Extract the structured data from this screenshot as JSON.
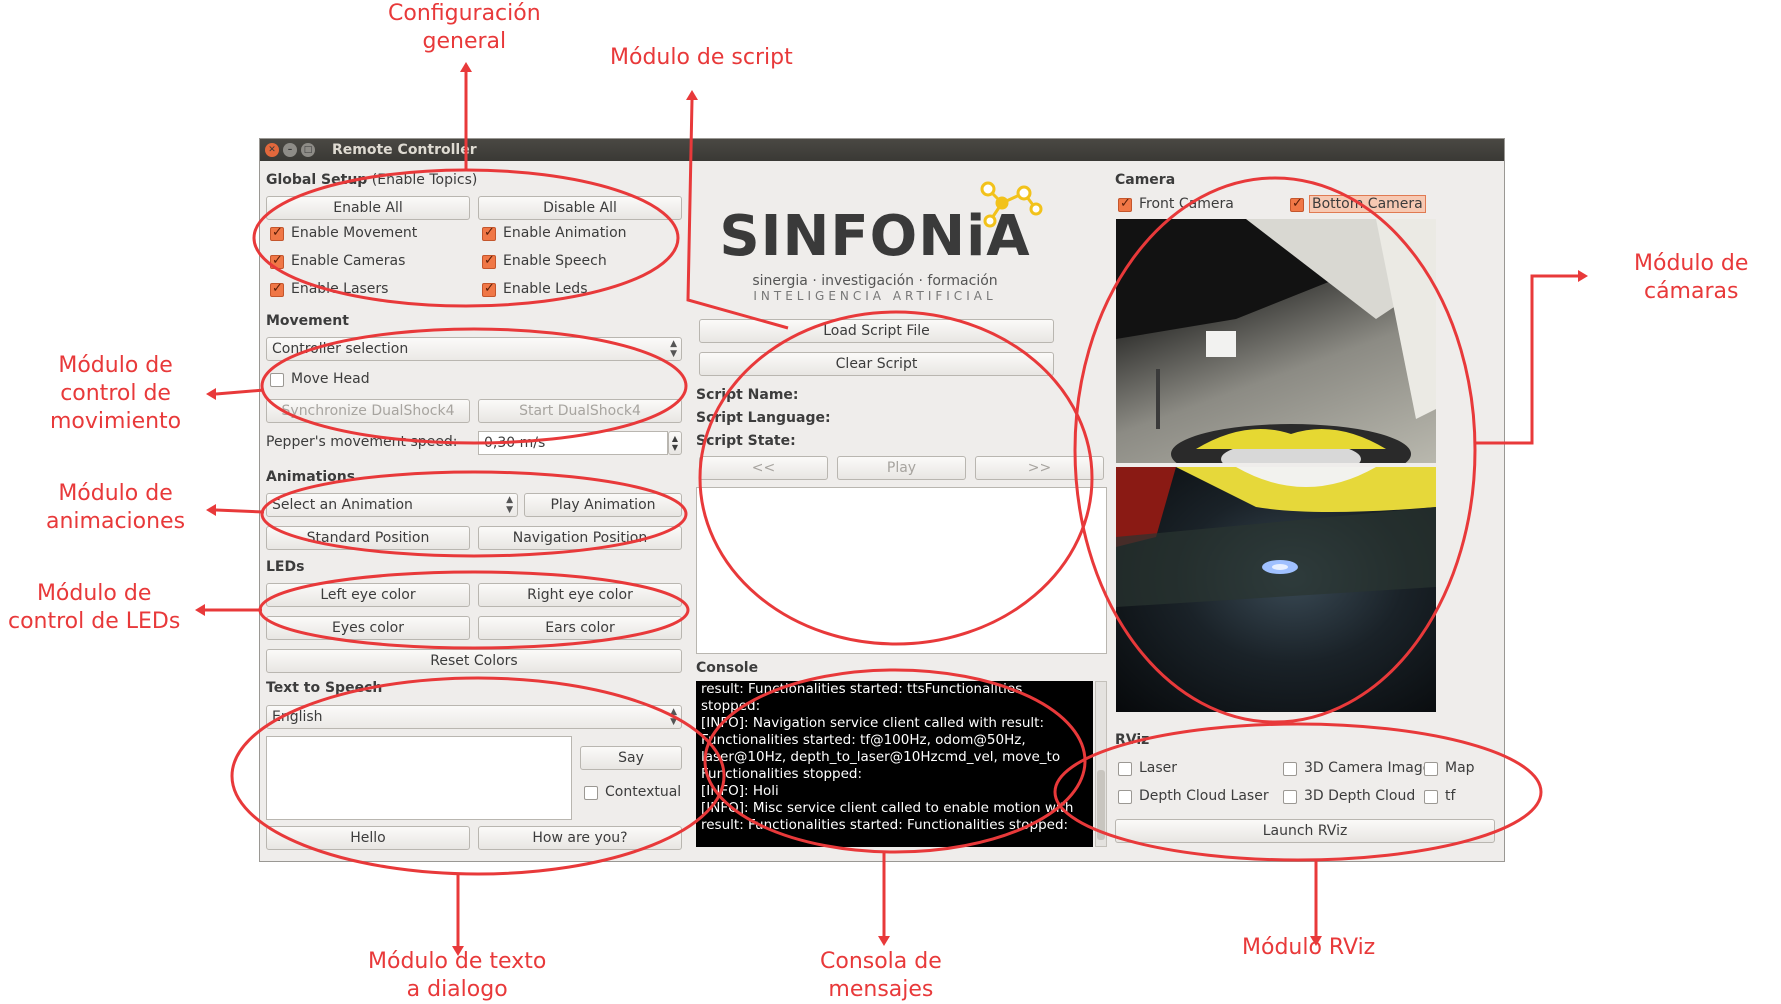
{
  "window": {
    "title": "Remote Controller"
  },
  "global_setup": {
    "header_bold": "Global Setup",
    "header_rest": "(Enable Topics)",
    "enable_all": "Enable All",
    "disable_all": "Disable All",
    "checks": [
      {
        "label": "Enable Movement",
        "checked": true
      },
      {
        "label": "Enable Animation",
        "checked": true
      },
      {
        "label": "Enable Cameras",
        "checked": true
      },
      {
        "label": "Enable Speech",
        "checked": true
      },
      {
        "label": "Enable Lasers",
        "checked": true
      },
      {
        "label": "Enable Leds",
        "checked": true
      }
    ]
  },
  "movement": {
    "header": "Movement",
    "controller_selection": "Controller selection",
    "move_head": "Move Head",
    "sync_dualshock": "Synchronize DualShock4",
    "start_dualshock": "Start DualShock4",
    "speed_label": "Pepper's movement speed:",
    "speed_value": "0,30 m/s"
  },
  "animations": {
    "header": "Animations",
    "select": "Select an Animation",
    "play": "Play Animation",
    "standard": "Standard Position",
    "navigation": "Navigation Position"
  },
  "leds": {
    "header": "LEDs",
    "left_eye": "Left eye color",
    "right_eye": "Right eye color",
    "eyes": "Eyes color",
    "ears": "Ears color",
    "reset": "Reset Colors"
  },
  "tts": {
    "header": "Text to Speech",
    "language": "English",
    "say": "Say",
    "contextual": "Contextual",
    "hello": "Hello",
    "how_are_you": "How are you?"
  },
  "logo": {
    "name": "SINFONiA",
    "tagline1": "sinergia · investigación · formación",
    "tagline2": "INTELIGENCIA ARTIFICIAL",
    "colors": {
      "text": "#3a3a3a",
      "accent": "#f2c21b",
      "accent2": "#1f7fc7"
    }
  },
  "script": {
    "load": "Load Script File",
    "clear": "Clear Script",
    "name_label": "Script Name:",
    "language_label": "Script Language:",
    "state_label": "Script State:",
    "prev": "<<",
    "play": "Play",
    "next": ">>"
  },
  "console": {
    "header": "Console",
    "lines": [
      "result: Functionalities started: ttsFunctionalities",
      "stopped:",
      "[INFO]: Navigation service client called with result:",
      "Functionalities started: tf@100Hz, odom@50Hz,",
      "laser@10Hz, depth_to_laser@10Hzcmd_vel, move_to",
      "Functionalities stopped:",
      "[INFO]: Holi",
      "[INFO]: Misc service client called to enable motion with",
      "result: Functionalities started: Functionalities stopped:"
    ]
  },
  "camera": {
    "header": "Camera",
    "front": "Front Camera",
    "bottom": "Bottom Camera"
  },
  "rviz": {
    "header": "RViz",
    "options": [
      {
        "label": "Laser",
        "checked": false
      },
      {
        "label": "3D Camera Image",
        "checked": false
      },
      {
        "label": "Map",
        "checked": false
      },
      {
        "label": "Depth Cloud Laser",
        "checked": false
      },
      {
        "label": "3D Depth Cloud",
        "checked": false
      },
      {
        "label": "tf",
        "checked": false
      }
    ],
    "launch": "Launch RViz"
  },
  "annotations": {
    "config_general": [
      "Configuración",
      "general"
    ],
    "modulo_script": "Módulo de script",
    "modulo_camaras": [
      "Módulo de",
      "cámaras"
    ],
    "control_movimiento": [
      "Módulo de",
      "control de",
      "movimiento"
    ],
    "animaciones": [
      "Módulo de",
      "animaciones"
    ],
    "control_leds": [
      "Módulo de",
      "control de LEDs"
    ],
    "texto_dialogo": [
      "Módulo de texto",
      "a dialogo"
    ],
    "consola": [
      "Consola de",
      "mensajes"
    ],
    "rviz": "Módulo RViz",
    "color": "#e8393a"
  }
}
